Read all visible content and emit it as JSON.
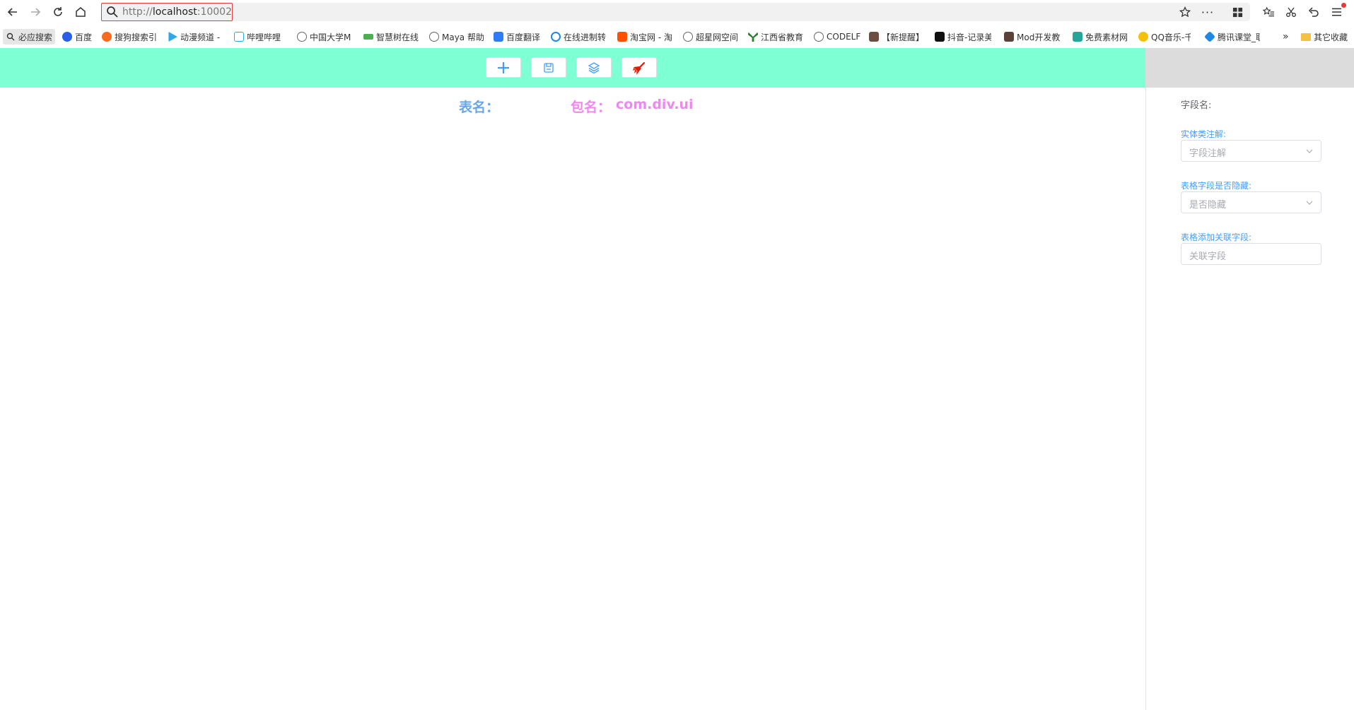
{
  "browser": {
    "url_scheme": "http://",
    "url_host": "localhost",
    "url_port": ":10002",
    "bookmarks": [
      {
        "label": "必应搜索",
        "color": "#4285f4"
      },
      {
        "label": "百度",
        "color": "#2b5ee8"
      },
      {
        "label": "搜狗搜索引",
        "color": "#fb6b1f"
      },
      {
        "label": "动漫频道 -",
        "color": "#2ea8e8"
      },
      {
        "label": "哔哩哔哩",
        "color": "#23ade5"
      },
      {
        "label": "中国大学M",
        "color": "#666666"
      },
      {
        "label": "智慧树在线",
        "color": "#4caf50"
      },
      {
        "label": "Maya 帮助",
        "color": "#666666"
      },
      {
        "label": "百度翻译",
        "color": "#2f7cf6"
      },
      {
        "label": "在线进制转",
        "color": "#1e88e5"
      },
      {
        "label": "淘宝网 - 淘",
        "color": "#ff5000"
      },
      {
        "label": "超星网空间",
        "color": "#666666"
      },
      {
        "label": "江西省教育",
        "color": "#2e7d32"
      },
      {
        "label": "CODELF",
        "color": "#666666"
      },
      {
        "label": "【新提醒】",
        "color": "#6d4c41"
      },
      {
        "label": "抖音-记录美",
        "color": "#111111"
      },
      {
        "label": "Mod开发教",
        "color": "#5d4037"
      },
      {
        "label": "免费素材网",
        "color": "#26a69a"
      },
      {
        "label": "QQ音乐-千",
        "color": "#f4c20d"
      },
      {
        "label": "腾讯课堂_职",
        "color": "#1e88e5"
      }
    ],
    "more_label": "»",
    "other_bookmarks": "其它收藏"
  },
  "app": {
    "table_name_label": "表名：",
    "package_label": "包名：",
    "package_value": "com.div.ui"
  },
  "panel": {
    "field_name_label": "字段名:",
    "entity_annotation_label": "实体类注解:",
    "entity_annotation_placeholder": "字段注解",
    "hidden_label": "表格字段是否隐藏:",
    "hidden_placeholder": "是否隐藏",
    "relation_label": "表格添加关联字段:",
    "relation_placeholder": "关联字段"
  },
  "colors": {
    "toolbar_bg": "#7fffd4",
    "table_label": "#6aa6e6",
    "package_label": "#ee88ee",
    "icon_blue": "#409eff",
    "broom_red": "#d81e06"
  }
}
